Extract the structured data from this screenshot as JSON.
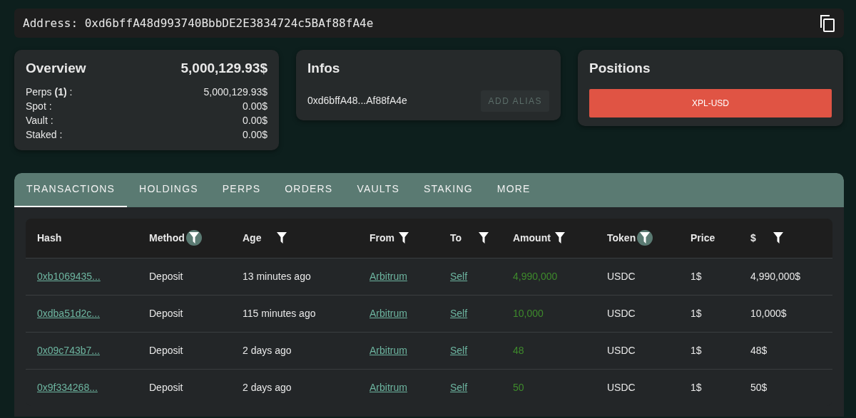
{
  "address": {
    "label": "Address:",
    "value": "0xd6bffA48d993740BbbDE2E3834724c5BAf88fA4e"
  },
  "overview": {
    "title": "Overview",
    "total": "5,000,129.93$",
    "rows": [
      {
        "label": "Perps **(1)** :",
        "value": "5,000,129.93$"
      },
      {
        "label": "Spot :",
        "value": "0.00$"
      },
      {
        "label": "Vault :",
        "value": "0.00$"
      },
      {
        "label": "Staked :",
        "value": "0.00$"
      }
    ]
  },
  "infos": {
    "title": "Infos",
    "address": "0xd6bffA48...Af88fA4e",
    "button": {
      "label": "ADD ALIAS",
      "disabled": true
    }
  },
  "positions": {
    "title": "Positions",
    "items": [
      {
        "label": "XPL-USD",
        "color": "#e05444"
      }
    ]
  },
  "tabs": [
    {
      "label": "TRANSACTIONS",
      "selected": true
    },
    {
      "label": "HOLDINGS",
      "selected": false
    },
    {
      "label": "PERPS",
      "selected": false
    },
    {
      "label": "ORDERS",
      "selected": false
    },
    {
      "label": "VAULTS",
      "selected": false
    },
    {
      "label": "STAKING",
      "selected": false
    },
    {
      "label": "MORE",
      "selected": false
    }
  ],
  "table": {
    "columns": [
      {
        "label": "Hash",
        "kind": "plain"
      },
      {
        "label": "Method",
        "kind": "filter",
        "filtered": true
      },
      {
        "label": "Age",
        "kind": "filter",
        "filtered": false
      },
      {
        "label": "From",
        "kind": "filter",
        "filtered": false
      },
      {
        "label": "To",
        "kind": "filter",
        "filtered": false
      },
      {
        "label": "Amount",
        "kind": "filter",
        "filtered": false
      },
      {
        "label": "Token",
        "kind": "filter",
        "filtered": true
      },
      {
        "label": "Price",
        "kind": "plain"
      },
      {
        "label": "$",
        "kind": "filter",
        "filtered": false
      }
    ],
    "rows": [
      {
        "hash": "0xb1069435...",
        "method": "Deposit",
        "age": "13 minutes ago",
        "from": "Arbitrum",
        "to": "Self",
        "amount": "4,990,000",
        "token": "USDC",
        "price": "1$",
        "usd": "4,990,000$"
      },
      {
        "hash": "0xdba51d2c...",
        "method": "Deposit",
        "age": "115 minutes ago",
        "from": "Arbitrum",
        "to": "Self",
        "amount": "10,000",
        "token": "USDC",
        "price": "1$",
        "usd": "10,000$"
      },
      {
        "hash": "0x09c743b7...",
        "method": "Deposit",
        "age": "2 days ago",
        "from": "Arbitrum",
        "to": "Self",
        "amount": "48",
        "token": "USDC",
        "price": "1$",
        "usd": "48$"
      },
      {
        "hash": "0x9f334268...",
        "method": "Deposit",
        "age": "2 days ago",
        "from": "Arbitrum",
        "to": "Self",
        "amount": "50",
        "token": "USDC",
        "price": "1$",
        "usd": "50$"
      }
    ]
  }
}
